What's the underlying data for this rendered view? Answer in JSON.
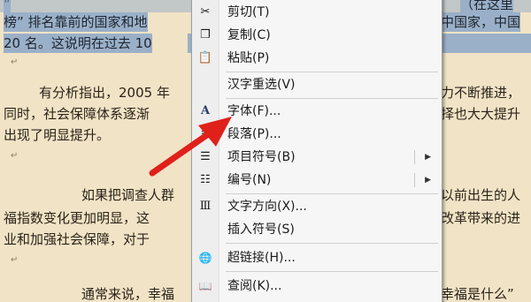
{
  "document": {
    "lines": [
      {
        "text": "“",
        "selected": true
      },
      {
        "text": "榜” 排名靠前的国家和地",
        "selected": true
      },
      {
        "text": "中国家，中国",
        "selected": true
      },
      {
        "text": "20 名。这说明在过去 10",
        "selected": true
      },
      {
        "text": "有分析指出，2005 年",
        "selected": false
      },
      {
        "text": "同时，社会保障体系逐渐",
        "selected": false
      },
      {
        "text": "出现了明显提升。",
        "selected": false
      },
      {
        "text": "如果把调查人群",
        "selected": false
      },
      {
        "text": "福指数变化更加明显，这",
        "selected": false
      },
      {
        "text": "业和加强社会保障，对于",
        "selected": false
      },
      {
        "text": "通常来说，幸福",
        "selected": false
      },
      {
        "text": "力不断推进，",
        "selected": false
      },
      {
        "text": "择也大大提升",
        "selected": false
      },
      {
        "text": "以前出生的人",
        "selected": false
      },
      {
        "text": "改革带来的进",
        "selected": false
      },
      {
        "text": "幸福是什么”",
        "selected": false
      },
      {
        "text": "（在这里",
        "selected": true
      }
    ]
  },
  "context_menu": {
    "items": [
      {
        "label": "剪切(T)",
        "icon": "cut-icon",
        "glyph": "✂"
      },
      {
        "label": "复制(C)",
        "icon": "copy-icon",
        "glyph": "❐"
      },
      {
        "label": "粘贴(P)",
        "icon": "paste-icon",
        "glyph": "📋"
      },
      {
        "label": "汉字重选(V)",
        "icon": "",
        "glyph": ""
      },
      {
        "label": "字体(F)...",
        "icon": "font-icon",
        "glyph": "A"
      },
      {
        "label": "段落(P)...",
        "icon": "paragraph-icon",
        "glyph": "≡"
      },
      {
        "label": "项目符号(B)",
        "icon": "bullets-icon",
        "glyph": "☰",
        "submenu": true
      },
      {
        "label": "编号(N)",
        "icon": "numbering-icon",
        "glyph": "☷",
        "submenu": true
      },
      {
        "label": "文字方向(X)...",
        "icon": "text-direction-icon",
        "glyph": "Ⅲ"
      },
      {
        "label": "插入符号(S)",
        "icon": "",
        "glyph": ""
      },
      {
        "label": "超链接(H)...",
        "icon": "hyperlink-icon",
        "glyph": "🌐"
      },
      {
        "label": "查阅(K)...",
        "icon": "research-icon",
        "glyph": "📖"
      }
    ]
  },
  "colors": {
    "paper": "#f1e3c6",
    "selection": "#9ab0c8",
    "arrow": "#e0201a"
  }
}
